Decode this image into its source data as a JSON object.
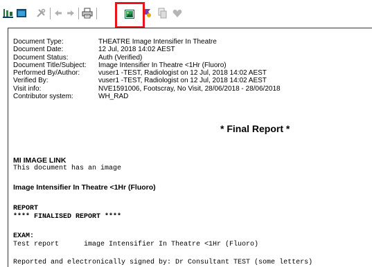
{
  "toolbar": {
    "highlight_color": "#e8131b",
    "icons": [
      "app-icon",
      "window-icon",
      "tools-icon",
      "back-arrow-icon",
      "forward-arrow-icon",
      "print-icon",
      "image-icon",
      "flag-icon",
      "copy-icon",
      "heart-icon"
    ]
  },
  "document": {
    "metadata": [
      {
        "label": "Document Type:",
        "value": "THEATRE Image Intensifier In Theatre"
      },
      {
        "label": "Document Date:",
        "value": "12 Jul, 2018 14:02 AEST"
      },
      {
        "label": "Document Status:",
        "value": "Auth (Verified)"
      },
      {
        "label": "Document Title/Subject:",
        "value": "Image Intensifier In Theatre <1Hr (Fluoro)"
      },
      {
        "label": "Performed By/Author:",
        "value": "vuser1 -TEST, Radiologist on 12 Jul, 2018 14:02 AEST"
      },
      {
        "label": "Verified By:",
        "value": "vuser1 -TEST, Radiologist on 12 Jul, 2018 14:02 AEST"
      },
      {
        "label": "Visit info:",
        "value": "NVE1591006, Footscray, No Visit, 28/06/2018 - 28/06/2018"
      },
      {
        "label": "Contributor system:",
        "value": "WH_RAD"
      }
    ],
    "final_report": "* Final Report *",
    "mi_image_link": "MI IMAGE LINK",
    "image_note": "This document has an image",
    "exam_title": "Image Intensifier In Theatre <1Hr (Fluoro)",
    "report_heading": "REPORT",
    "finalised": "**** FINALISED REPORT ****",
    "exam_heading": "EXAM:",
    "exam_line": "Test report      image Intensifier In Theatre <1Hr (Fluoro)",
    "signed_line": "Reported and electronically signed by: Dr Consultant TEST (some letters)"
  }
}
